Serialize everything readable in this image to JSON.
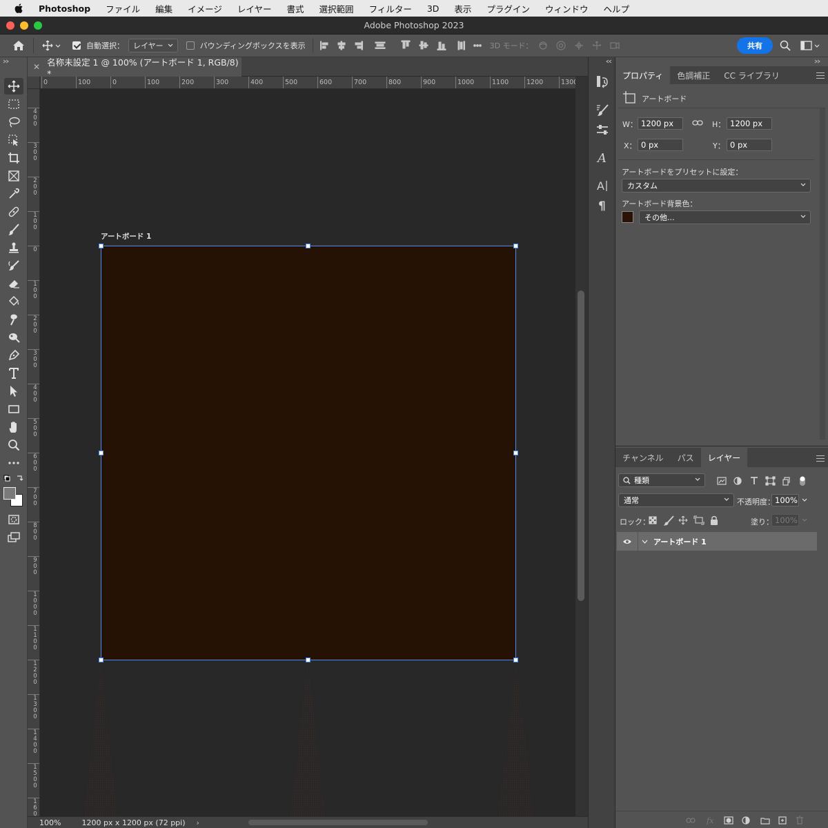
{
  "menubar": {
    "app": "Photoshop",
    "items": [
      "ファイル",
      "編集",
      "イメージ",
      "レイヤー",
      "書式",
      "選択範囲",
      "フィルター",
      "3D",
      "表示",
      "プラグイン",
      "ウィンドウ",
      "ヘルプ"
    ]
  },
  "window": {
    "title": "Adobe Photoshop 2023"
  },
  "options": {
    "auto_select_label": "自動選択：",
    "auto_select_value": "レイヤー",
    "bbox_label": "バウンディングボックスを表示",
    "mode3d_label": "3D モード：",
    "share_label": "共有"
  },
  "document": {
    "tab_title": "名称未設定 1 @ 100% (アートボード 1, RGB/8) *",
    "artboard_label": "アートボード 1",
    "artboard_color": "#261204"
  },
  "ruler_top": [
    "0",
    "100",
    "0",
    "100",
    "200",
    "300",
    "400",
    "500",
    "600",
    "700",
    "800",
    "900",
    "1000",
    "1100",
    "1200",
    "1300"
  ],
  "ruler_left": [
    "4\n0\n0",
    "3\n0\n0",
    "2\n0\n0",
    "1\n0\n0",
    "0",
    "1\n0\n0",
    "2\n0\n0",
    "3\n0\n0",
    "4\n0\n0",
    "5\n0\n0",
    "6\n0\n0",
    "7\n0\n0",
    "8\n0\n0",
    "9\n0\n0",
    "1\n0\n0\n0",
    "1\n1\n0\n0",
    "1\n2\n0\n0",
    "1\n3\n0\n0",
    "1\n4\n0\n0",
    "1\n5\n0\n0",
    "1\n6\n0"
  ],
  "status": {
    "zoom": "100%",
    "doc_size": "1200 px x 1200 px (72 ppi)"
  },
  "properties": {
    "tabs": [
      "プロパティ",
      "色調補正",
      "CC ライブラリ"
    ],
    "kind": "アートボード",
    "w_label": "W：",
    "w_value": "1200 px",
    "h_label": "H：",
    "h_value": "1200 px",
    "x_label": "X：",
    "x_value": "0 px",
    "y_label": "Y：",
    "y_value": "0 px",
    "preset_label": "アートボードをプリセットに設定：",
    "preset_value": "カスタム",
    "bg_label": "アートボード背景色：",
    "bg_value": "その他...",
    "bg_color": "#2a1206"
  },
  "layers": {
    "tabs": [
      "チャンネル",
      "パス",
      "レイヤー"
    ],
    "filter_value": "種類",
    "blend_value": "通常",
    "opacity_label": "不透明度：",
    "opacity_value": "100%",
    "lock_label": "ロック：",
    "fill_label": "塗り：",
    "fill_value": "100%",
    "layer_name": "アートボード 1"
  }
}
